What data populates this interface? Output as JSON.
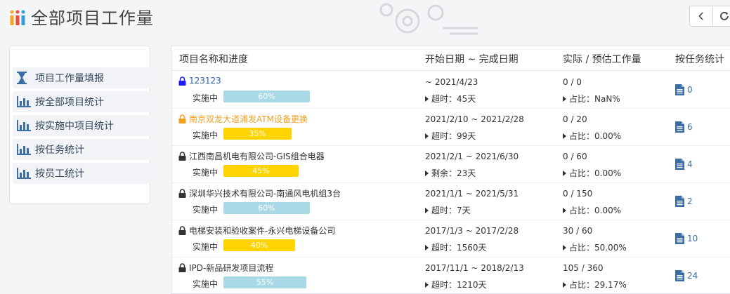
{
  "header": {
    "title": "全部项目工作量",
    "back_icon": "chevron-left-icon",
    "refresh_icon": "refresh-icon"
  },
  "sidebar": {
    "items": [
      {
        "label": "项目工作量填报",
        "icon": "hourglass-icon"
      },
      {
        "label": "按全部项目统计",
        "icon": "bar-chart-icon"
      },
      {
        "label": "按实施中项目统计",
        "icon": "bar-chart-icon"
      },
      {
        "label": "按任务统计",
        "icon": "bar-chart-icon"
      },
      {
        "label": "按员工统计",
        "icon": "bar-chart-icon"
      }
    ]
  },
  "table": {
    "headers": [
      "项目名称和进度",
      "开始日期 ~ 完成日期",
      "实际 / 预估工作量",
      "按任务统计"
    ],
    "rows": [
      {
        "name": "123123",
        "lock_color": "#1a1aff",
        "name_color": "#2a5fb0",
        "state": "实施中",
        "progress": "60%",
        "bar_color": "#a9d8e6",
        "dates": "~ 2021/4/23",
        "time_status": "超时：45天",
        "workload": "0 / 0",
        "ratio": "占比：NaN%",
        "tasks": "0"
      },
      {
        "name": "南京双龙大道浦发ATM设备更换",
        "lock_color": "#f0a020",
        "name_color": "#f0a020",
        "state": "实施中",
        "progress": "35%",
        "bar_color": "#ffd400",
        "dates": "2021/2/10 ~ 2021/2/28",
        "time_status": "超时：99天",
        "workload": "0 / 20",
        "ratio": "占比：0.00%",
        "tasks": "6"
      },
      {
        "name": "江西南昌机电有限公司-GIS组合电器",
        "lock_color": "#333333",
        "name_color": "#333333",
        "state": "实施中",
        "progress": "45%",
        "bar_color": "#ffd400",
        "dates": "2021/2/1 ~ 2021/6/30",
        "time_status": "剩余：23天",
        "workload": "0 / 60",
        "ratio": "占比：0.00%",
        "tasks": "4"
      },
      {
        "name": "深圳华兴技术有限公司-南通风电机组3台",
        "lock_color": "#333333",
        "name_color": "#333333",
        "state": "实施中",
        "progress": "60%",
        "bar_color": "#a9d8e6",
        "dates": "2021/1/1 ~ 2021/5/31",
        "time_status": "超时：7天",
        "workload": "0 / 150",
        "ratio": "占比：0.00%",
        "tasks": "2"
      },
      {
        "name": "电梯安装和验收案件-永兴电梯设备公司",
        "lock_color": "#333333",
        "name_color": "#333333",
        "state": "实施中",
        "progress": "40%",
        "bar_color": "#ffd400",
        "dates": "2017/1/3 ~ 2017/2/28",
        "time_status": "超时：1560天",
        "workload": "30 / 60",
        "ratio": "占比：50.00%",
        "tasks": "10"
      },
      {
        "name": "IPD-新品研发项目流程",
        "lock_color": "#333333",
        "name_color": "#333333",
        "state": "实施中",
        "progress": "55%",
        "bar_color": "#a9d8e6",
        "dates": "2017/11/1 ~ 2018/2/13",
        "time_status": "超时：1210天",
        "workload": "105 / 360",
        "ratio": "占比：29.17%",
        "tasks": "24"
      }
    ]
  }
}
